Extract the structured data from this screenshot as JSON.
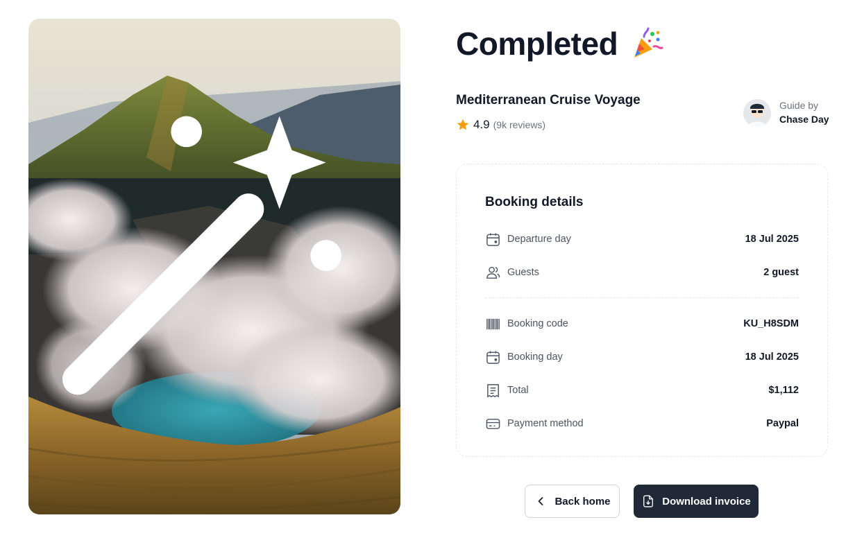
{
  "header": {
    "title": "Completed",
    "celebration_icon": "party-popper-icon"
  },
  "trip": {
    "name": "Mediterranean Cruise Voyage",
    "rating": "4.9",
    "reviews": "(9k reviews)",
    "rating_icon": "star-icon",
    "rating_color": "#f59e0b"
  },
  "guide": {
    "label": "Guide by",
    "name": "Chase Day"
  },
  "booking": {
    "title": "Booking details",
    "rows_top": [
      {
        "icon": "calendar-icon",
        "label": "Departure day",
        "value": "18 Jul 2025"
      },
      {
        "icon": "users-icon",
        "label": "Guests",
        "value": "2 guest"
      }
    ],
    "rows_bottom": [
      {
        "icon": "barcode-icon",
        "label": "Booking code",
        "value": "KU_H8SDM"
      },
      {
        "icon": "calendar-icon",
        "label": "Booking day",
        "value": "18 Jul 2025"
      },
      {
        "icon": "receipt-icon",
        "label": "Total",
        "value": "$1,112"
      },
      {
        "icon": "credit-card-icon",
        "label": "Payment method",
        "value": "Paypal"
      }
    ]
  },
  "actions": {
    "back_label": "Back home",
    "download_label": "Download invoice"
  },
  "colors": {
    "primary_dark": "#1f2937",
    "text_muted": "#4b5563"
  }
}
